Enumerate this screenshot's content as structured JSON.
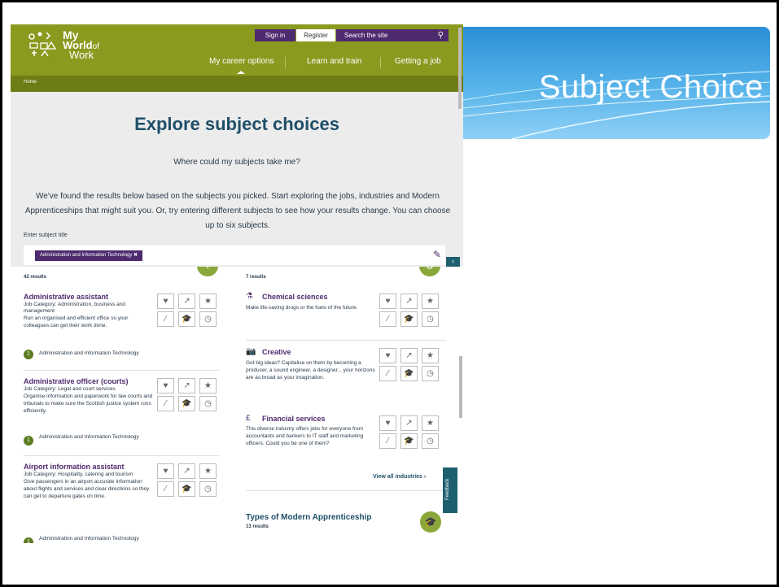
{
  "slide": {
    "title": "Subject Choice"
  },
  "site": {
    "logo": {
      "line1": "My",
      "line2_a": "World",
      "line2_b": "of",
      "line3": "Work"
    },
    "sign_in": "Sign in",
    "register": "Register",
    "search_placeholder": "Search the site",
    "nav": [
      "My career options",
      "Learn and train",
      "Getting a job"
    ],
    "breadcrumb": "Home",
    "heading": "Explore subject choices",
    "subheading": "Where could my subjects take me?",
    "description": "We've found the results below based on the subjects you picked. Start exploring the jobs, industries and Modern Apprenticeships that might suit you. Or, try entering different subjects to see how your results change. You can choose up to six subjects.",
    "enter_label": "Enter subject title",
    "selected_subject": "Administration and Information Technology"
  },
  "jobs": {
    "count": "42 results",
    "items": [
      {
        "title": "Administrative assistant",
        "category": "Job Category: Administration, business and management",
        "desc": "Run an organised and efficient office so your colleagues can get their work done.",
        "subject": "Administration and Information Technology"
      },
      {
        "title": "Administrative officer (courts)",
        "category": "Job Category: Legal and court services",
        "desc": "Organise information and paperwork for law courts and tribunals to make sure the Scottish justice system runs efficiently.",
        "subject": "Administration and Information Technology"
      },
      {
        "title": "Airport information assistant",
        "category": "Job Category: Hospitality, catering and tourism",
        "desc": "Give passengers in an airport accurate information about flights and services and clear directions so they can get to departure gates on time.",
        "subject": "Administration and Information Technology"
      }
    ]
  },
  "industries": {
    "count": "7 results",
    "items": [
      {
        "title": "Chemical sciences",
        "desc": "Make life-saving drugs or the fuels of the future.",
        "icon": "flask-icon"
      },
      {
        "title": "Creative",
        "desc": "Got big ideas? Capitalise on them by becoming a producer, a sound engineer, a designer... your horizons are as broad as your imagination.",
        "icon": "camera-icon"
      },
      {
        "title": "Financial services",
        "desc": "This diverse industry offers jobs for everyone from accountants and bankers to IT staff and marketing officers. Could you be one of them?",
        "icon": "money-icon"
      }
    ],
    "view_all": "View all industries ›"
  },
  "apprenticeships": {
    "title": "Types of Modern Apprenticeship",
    "count": "13 results"
  },
  "feedback": "Feedback"
}
